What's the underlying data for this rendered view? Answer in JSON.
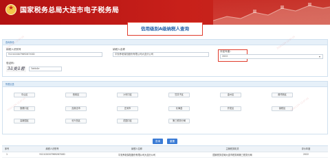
{
  "header": {
    "site_title": "国家税务总局大连市电子税务局"
  },
  "page": {
    "title": "信用级别A级纳税人查询"
  },
  "basic_section": {
    "heading": "查询条件",
    "taxpayer_id_label": "纳税人识别号",
    "taxpayer_id_value": "912102007969267XXD",
    "taxpayer_name_label": "纳税人名称",
    "taxpayer_name_value": "平安养老保险股份有限公司大连分公司",
    "year_label": "评定年度：",
    "year_value": "2022",
    "captcha_label": "验证码：",
    "captcha_image_text": "3ā支ā君",
    "captcha_value": "3ahb4e"
  },
  "region_section": {
    "heading": "所属区县",
    "regions": [
      "中山区",
      "西岗区",
      "沙河口区",
      "甘井子区",
      "金州区",
      "普湾新区",
      "旅顺口区",
      "瓦房店市",
      "庄河市",
      "长海县",
      "开发区",
      "保税区",
      "高新园区",
      "长兴岛区",
      "花园口区",
      "第三税务分局"
    ]
  },
  "actions": {
    "search_label": "查询",
    "reset_label": "重置"
  },
  "results": {
    "columns": [
      "序号",
      "纳税人识别号",
      "纳税人名称",
      "主管税务机关",
      "评价年度"
    ],
    "rows": [
      [
        "1",
        "912102007969267XXD",
        "平安养老保险股份有限公司大连分公司",
        "国家税务总局大连市税务局第三税务分局",
        "2022"
      ]
    ]
  },
  "watermark": {
    "text": "20221124 12:07:05"
  },
  "colors": {
    "header_red": "#c8201a",
    "title_blue": "#1d5da8",
    "highlight_red": "#e03a2a",
    "button_blue": "#3a7bd5"
  }
}
